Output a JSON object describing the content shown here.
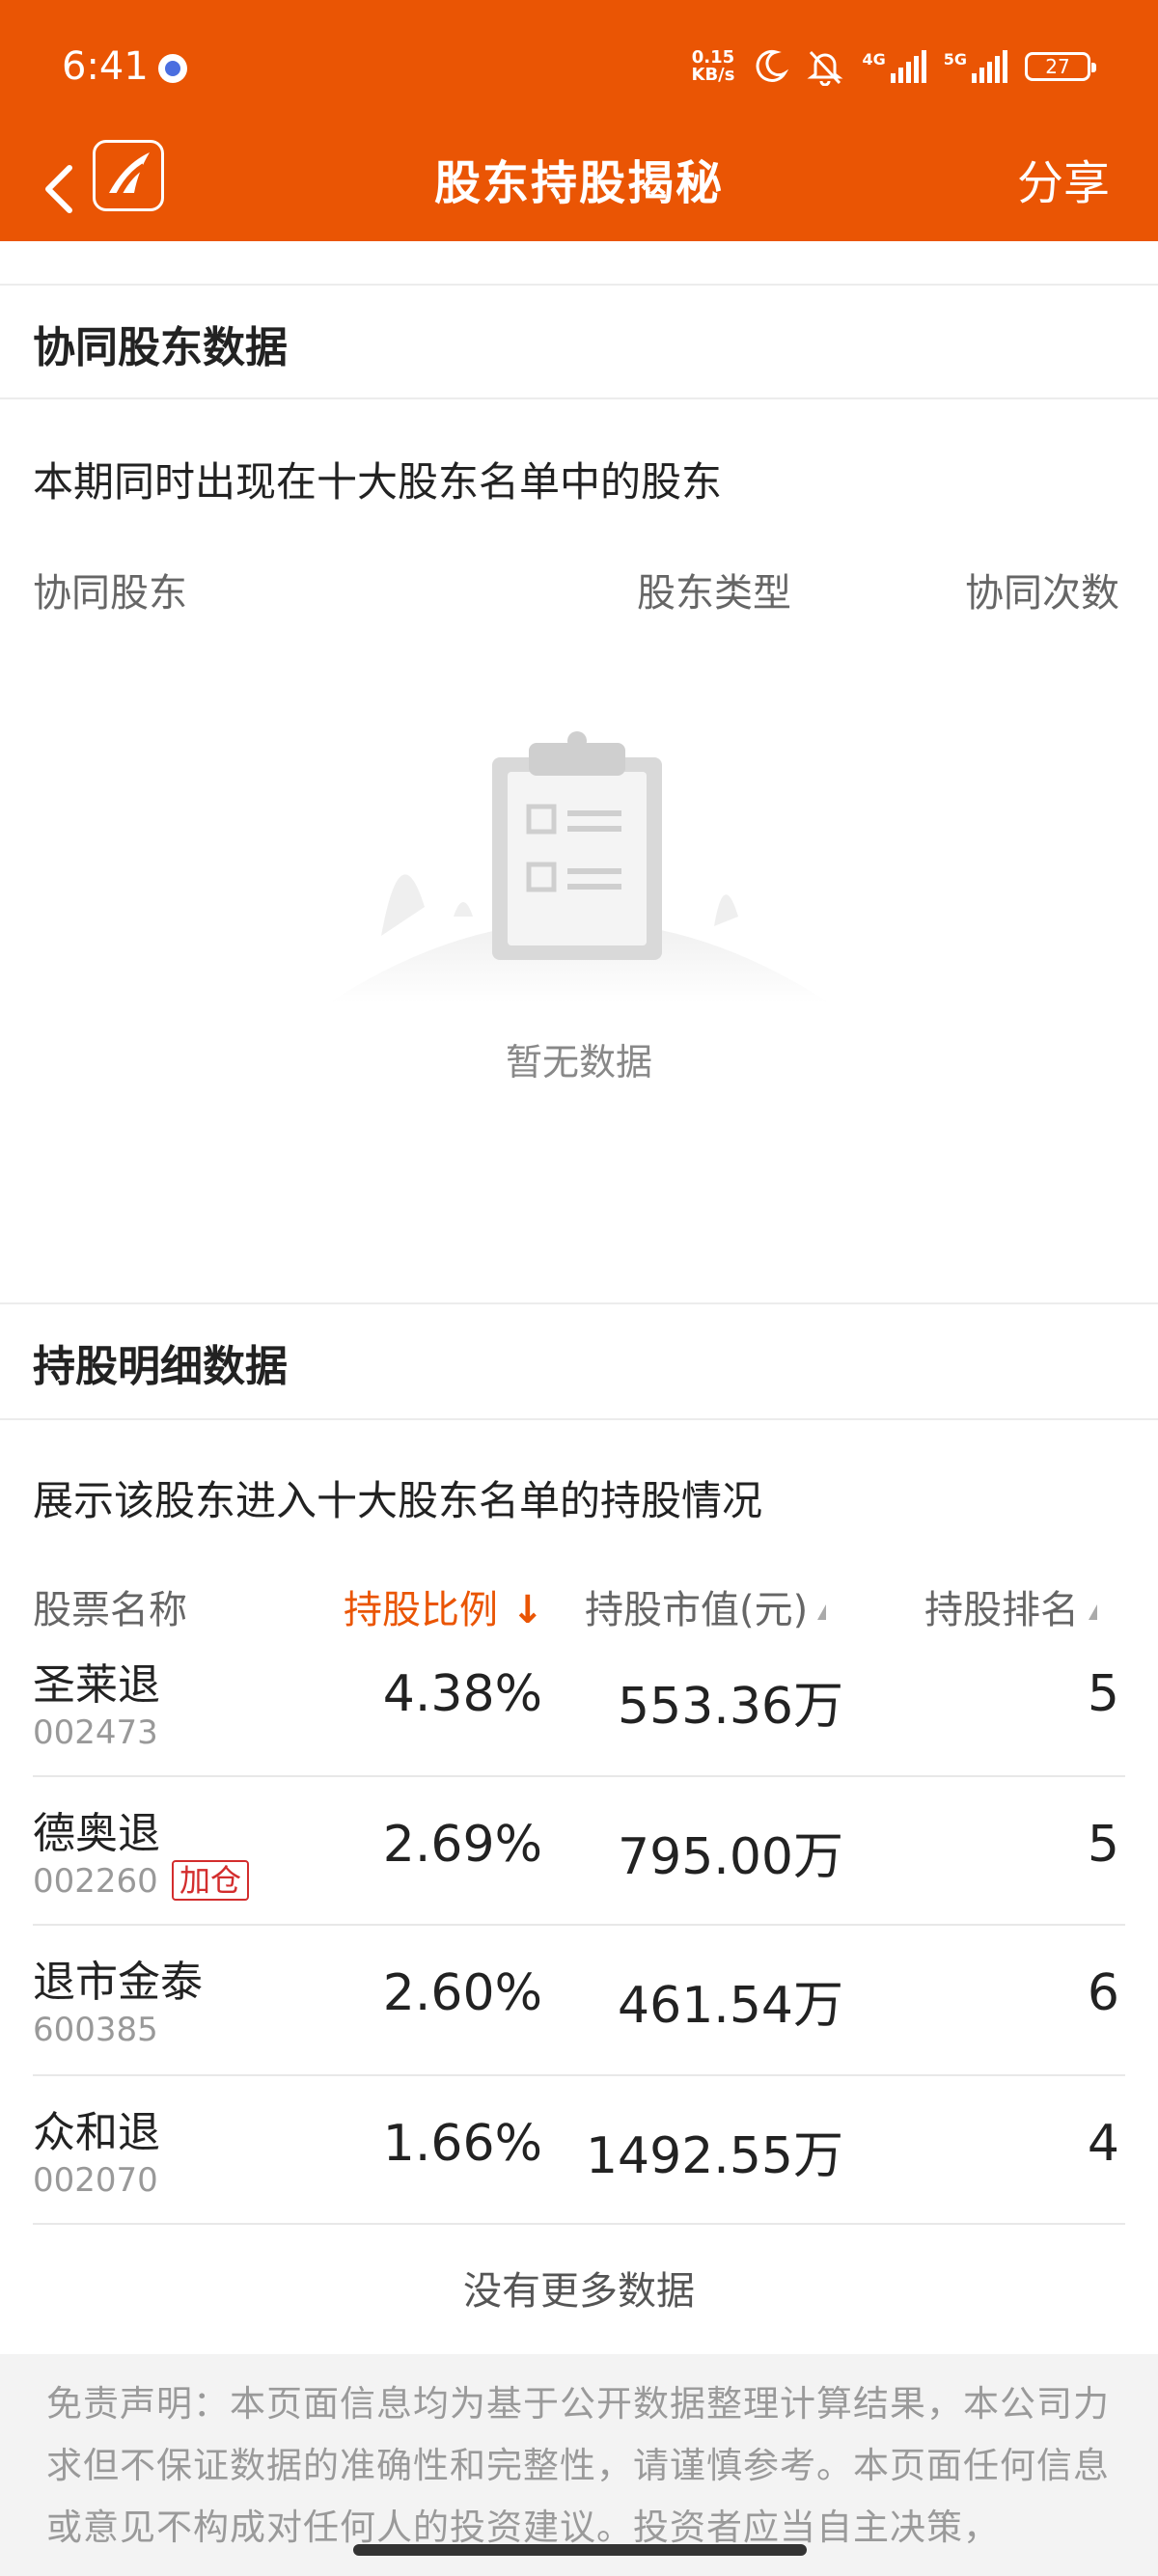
{
  "status_bar": {
    "time": "6:41",
    "net_speed_value": "0.15",
    "net_speed_unit": "KB/s",
    "signal1_label": "4G",
    "signal2_label": "5G",
    "battery": "27"
  },
  "nav": {
    "title": "股东持股揭秘",
    "share_label": "分享"
  },
  "collab_section": {
    "title": "协同股东数据",
    "description": "本期同时出现在十大股东名单中的股东",
    "columns": [
      "协同股东",
      "股东类型",
      "协同次数"
    ],
    "empty_text": "暂无数据"
  },
  "holding_section": {
    "title": "持股明细数据",
    "description": "展示该股东进入十大股东名单的持股情况",
    "columns": {
      "name": "股票名称",
      "ratio": "持股比例",
      "value": "持股市值(元)",
      "rank": "持股排名"
    },
    "rows": [
      {
        "name": "圣莱退",
        "code": "002473",
        "ratio": "4.38%",
        "value": "553.36万",
        "rank": "5",
        "tag": ""
      },
      {
        "name": "德奥退",
        "code": "002260",
        "ratio": "2.69%",
        "value": "795.00万",
        "rank": "5",
        "tag": "加仓"
      },
      {
        "name": "退市金泰",
        "code": "600385",
        "ratio": "2.60%",
        "value": "461.54万",
        "rank": "6",
        "tag": ""
      },
      {
        "name": "众和退",
        "code": "002070",
        "ratio": "1.66%",
        "value": "1492.55万",
        "rank": "4",
        "tag": ""
      }
    ],
    "no_more_text": "没有更多数据"
  },
  "disclaimer": "免责声明：本页面信息均为基于公开数据整理计算结果，本公司力求但不保证数据的准确性和完整性，请谨慎参考。本页面任何信息或意见不构成对任何人的投资建议。投资者应当自主决策，",
  "colors": {
    "brand_orange": "#ea5504",
    "sort_active": "#ea5504",
    "tag_red": "#d32d2d"
  }
}
